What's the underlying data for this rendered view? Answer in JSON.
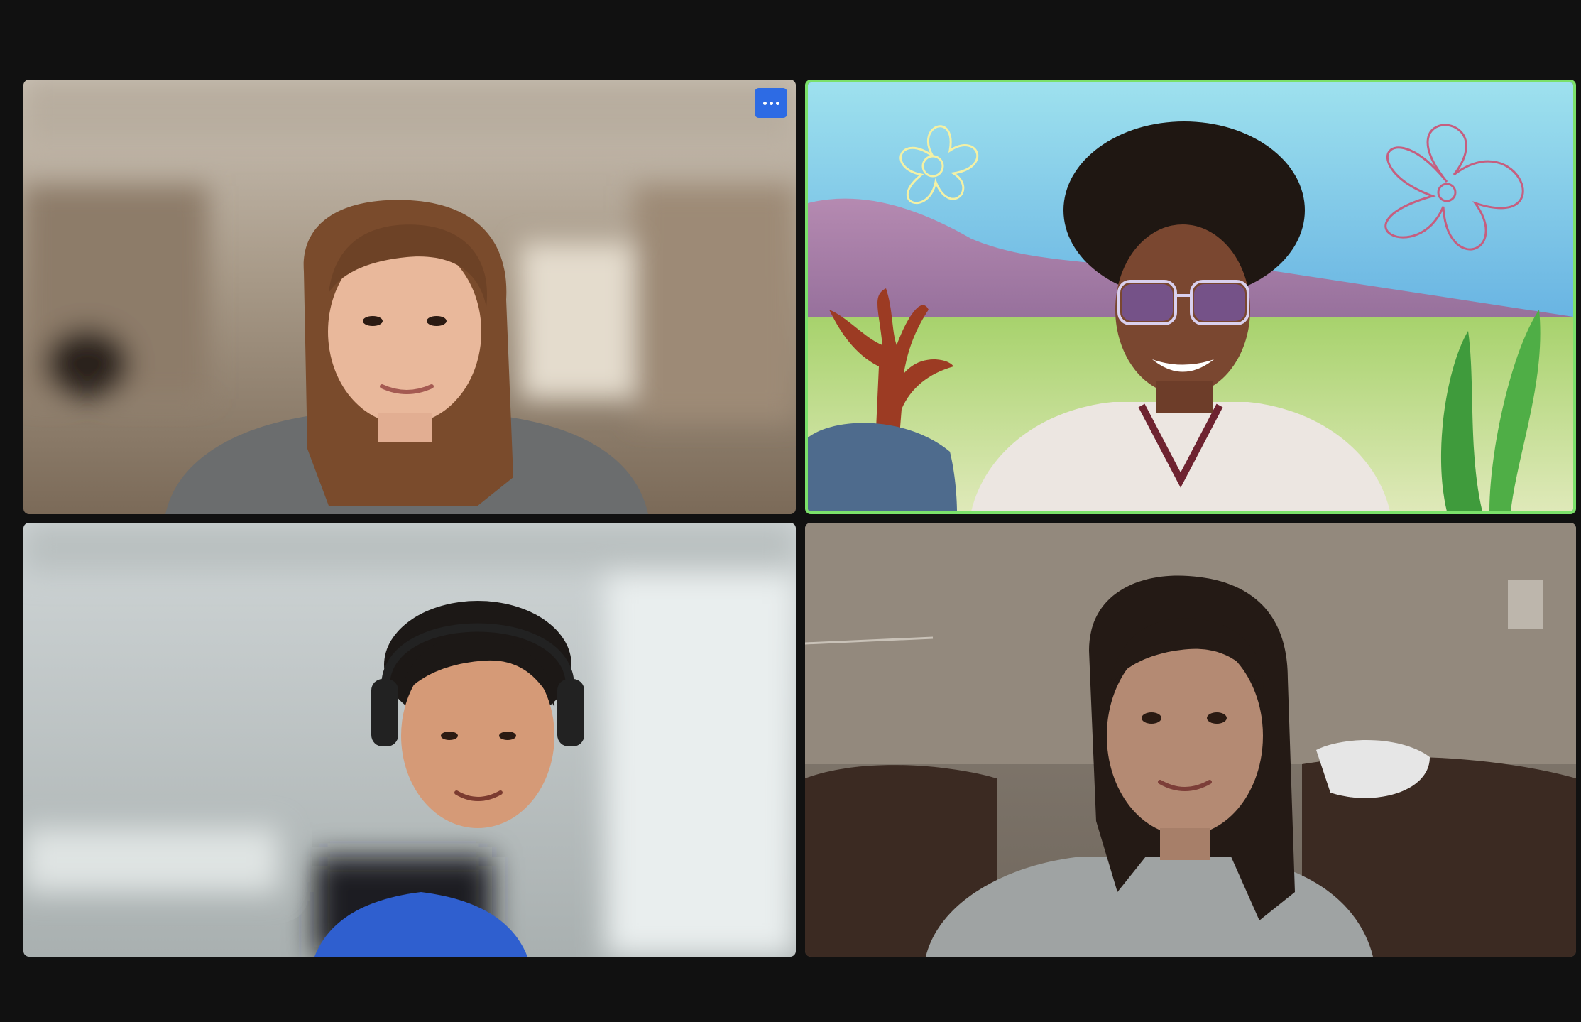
{
  "window": {
    "background_color": "#111111"
  },
  "participants": [
    {
      "id": "participant-1",
      "background": "blurred-room",
      "active_speaker": false,
      "has_more_button": true
    },
    {
      "id": "participant-2",
      "background": "cartoon-underwater-virtual-background",
      "active_speaker": true,
      "highlight_color": "#7BE06A",
      "has_more_button": false
    },
    {
      "id": "participant-3",
      "background": "blurred-white-room",
      "active_speaker": false,
      "has_more_button": false
    },
    {
      "id": "participant-4",
      "background": "dim-living-room",
      "active_speaker": false,
      "has_more_button": false
    }
  ],
  "controls": {
    "more_icon": "more-options-icon",
    "more_button_color": "#2D6BE4"
  }
}
